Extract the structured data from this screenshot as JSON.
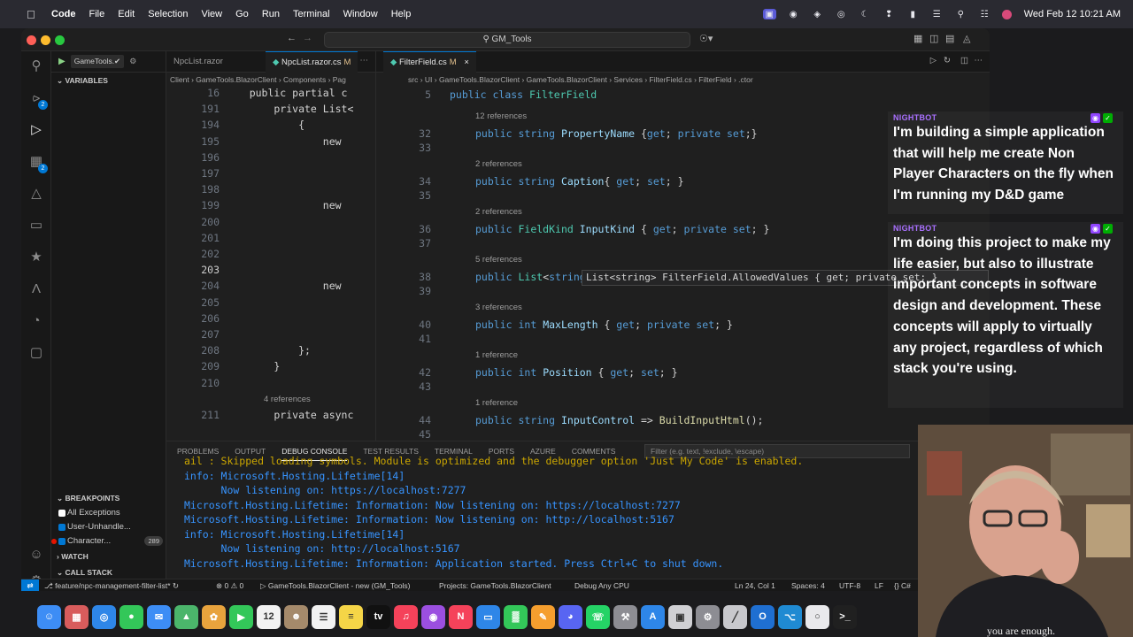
{
  "menubar": {
    "app": "Code",
    "menus": [
      "File",
      "Edit",
      "Selection",
      "View",
      "Go",
      "Run",
      "Terminal",
      "Window",
      "Help"
    ],
    "clock": "Wed Feb 12  10:21 AM"
  },
  "window": {
    "search": "GM_Tools"
  },
  "sidebar": {
    "debug_config": "GameTools.✔",
    "variables_header": "VARIABLES",
    "breakpoints_header": "BREAKPOINTS",
    "breakpoints": [
      {
        "label": "All Exceptions",
        "checked": false
      },
      {
        "label": "User-Unhandle...",
        "checked": true
      },
      {
        "label": "Character...",
        "checked": true,
        "count": "289"
      }
    ],
    "watch_header": "WATCH",
    "callstack_header": "CALL STACK"
  },
  "left_editor": {
    "tabs": [
      {
        "label": "NpcList.razor",
        "modified": ""
      },
      {
        "label": "NpcList.razor.cs",
        "modified": "M"
      }
    ],
    "breadcrumb": "Client › GameTools.BlazorClient › Components › Pag",
    "lines": [
      {
        "num": "16",
        "text": "    public partial c"
      },
      {
        "num": "191",
        "text": "        private List<"
      },
      {
        "num": "194",
        "text": "            {"
      },
      {
        "num": "195",
        "text": "                new "
      },
      {
        "num": "196",
        "text": "                    "
      },
      {
        "num": "197",
        "text": "                    "
      },
      {
        "num": "198",
        "text": "                    "
      },
      {
        "num": "199",
        "text": "                new "
      },
      {
        "num": "200",
        "text": "                    "
      },
      {
        "num": "201",
        "text": "                    "
      },
      {
        "num": "202",
        "text": "                    "
      },
      {
        "num": "203",
        "text": "                    "
      },
      {
        "num": "204",
        "text": "                new "
      },
      {
        "num": "205",
        "text": "                    "
      },
      {
        "num": "206",
        "text": "                    "
      },
      {
        "num": "207",
        "text": "                    "
      },
      {
        "num": "208",
        "text": "            };"
      },
      {
        "num": "209",
        "text": "        }"
      },
      {
        "num": "210",
        "text": ""
      },
      {
        "num": "",
        "text": "        4 references"
      },
      {
        "num": "211",
        "text": "        private async"
      }
    ]
  },
  "right_editor": {
    "tab": "FilterField.cs",
    "tab_modified": "M",
    "breadcrumb": "src › UI › GameTools.BlazorClient › GameTools.BlazorClient › Services › FilterField.cs › FilterField › .ctor",
    "sticky": {
      "num": "5",
      "text": "public class FilterField"
    },
    "hover": "List<string> FilterField.AllowedValues { get; private set; }",
    "members": [
      {
        "refs": "12 references",
        "num": "32",
        "code": "public string PropertyName {get; private set;}"
      },
      {
        "refs": "",
        "num": "33",
        "code": ""
      },
      {
        "refs": "2 references",
        "num": "34",
        "code": "public string Caption{ get; set; }"
      },
      {
        "refs": "",
        "num": "35",
        "code": ""
      },
      {
        "refs": "2 references",
        "num": "36",
        "code": "public FieldKind InputKind { get; private set; }"
      },
      {
        "refs": "",
        "num": "37",
        "code": ""
      },
      {
        "refs": "5 references",
        "num": "38",
        "code": "public List<string> AllowedValues { get; private set; }"
      },
      {
        "refs": "",
        "num": "39",
        "code": ""
      },
      {
        "refs": "3 references",
        "num": "40",
        "code": "public int MaxLength { get; private set; }"
      },
      {
        "refs": "",
        "num": "41",
        "code": ""
      },
      {
        "refs": "1 reference",
        "num": "42",
        "code": "public int Position { get; set; }"
      },
      {
        "refs": "",
        "num": "43",
        "code": ""
      },
      {
        "refs": "1 reference",
        "num": "44",
        "code": "public string InputControl => BuildInputHtml();"
      },
      {
        "refs": "",
        "num": "45",
        "code": ""
      }
    ]
  },
  "panel": {
    "tabs": [
      "PROBLEMS",
      "OUTPUT",
      "DEBUG CONSOLE",
      "TEST RESULTS",
      "TERMINAL",
      "PORTS",
      "AZURE",
      "COMMENTS"
    ],
    "active_tab": "DEBUG CONSOLE",
    "filter_placeholder": "Filter (e.g. text, !exclude, \\escape)",
    "lines": [
      {
        "text": "ail : Skipped loading symbols. Module is optimized and the debugger option 'Just My Code' is enabled.",
        "kind": "warn"
      },
      {
        "text": "info: Microsoft.Hosting.Lifetime[14]",
        "kind": "info"
      },
      {
        "text": "      Now listening on: https://localhost:7277",
        "kind": "info"
      },
      {
        "text": "Microsoft.Hosting.Lifetime: Information: Now listening on: https://localhost:7277",
        "kind": "info"
      },
      {
        "text": "Microsoft.Hosting.Lifetime: Information: Now listening on: http://localhost:5167",
        "kind": "info"
      },
      {
        "text": "info: Microsoft.Hosting.Lifetime[14]",
        "kind": "info"
      },
      {
        "text": "      Now listening on: http://localhost:5167",
        "kind": "info"
      },
      {
        "text": "Microsoft.Hosting.Lifetime: Information: Application started. Press Ctrl+C to shut down.",
        "kind": "info"
      }
    ]
  },
  "statusbar": {
    "branch": "feature/npc-management-filter-list*",
    "problems": "⊗ 0 ⚠ 0",
    "debug_target": "GameTools.BlazorClient - new (GM_Tools)",
    "projects": "Projects: GameTools.BlazorClient",
    "config": "Debug Any CPU",
    "position": "Ln 24, Col 1",
    "spaces": "Spaces: 4",
    "encoding": "UTF-8",
    "eol": "LF",
    "language": "{} C#"
  },
  "chat": [
    {
      "user": "NIGHTBOT",
      "message": "I'm building a simple application that will help me create Non Player Characters on the fly when I'm running my D&D game"
    },
    {
      "user": "NIGHTBOT",
      "message": "I'm doing this project to make my life easier, but also to illustrate important concepts in software design and development. These concepts will apply to virtually any project, regardless of which stack you're using."
    }
  ],
  "webcam": {
    "shirt_text": "you are enough."
  },
  "dock": {
    "apps": [
      {
        "name": "finder",
        "color": "#3d8df5",
        "glyph": "☺"
      },
      {
        "name": "launchpad",
        "color": "#d85c5c",
        "glyph": "▦"
      },
      {
        "name": "safari",
        "color": "#2e86e8",
        "glyph": "◎"
      },
      {
        "name": "messages",
        "color": "#33c759",
        "glyph": "●"
      },
      {
        "name": "mail",
        "color": "#3d8df5",
        "glyph": "✉"
      },
      {
        "name": "maps",
        "color": "#4bb56b",
        "glyph": "▲"
      },
      {
        "name": "photos",
        "color": "#e8a33d",
        "glyph": "✿"
      },
      {
        "name": "facetime",
        "color": "#33c759",
        "glyph": "▶"
      },
      {
        "name": "calendar",
        "color": "#f2f2f2",
        "glyph": "12"
      },
      {
        "name": "contacts",
        "color": "#a58a6b",
        "glyph": "☻"
      },
      {
        "name": "reminders",
        "color": "#f2f2f2",
        "glyph": "☰"
      },
      {
        "name": "notes",
        "color": "#f5d547",
        "glyph": "≡"
      },
      {
        "name": "tv",
        "color": "#111111",
        "glyph": "tv"
      },
      {
        "name": "music",
        "color": "#f5425a",
        "glyph": "♫"
      },
      {
        "name": "podcasts",
        "color": "#9b4fe0",
        "glyph": "◉"
      },
      {
        "name": "news",
        "color": "#f5425a",
        "glyph": "N"
      },
      {
        "name": "keynote",
        "color": "#2e86e8",
        "glyph": "▭"
      },
      {
        "name": "numbers",
        "color": "#33c759",
        "glyph": "▓"
      },
      {
        "name": "pages",
        "color": "#f59e2e",
        "glyph": "✎"
      },
      {
        "name": "discord",
        "color": "#5865f2",
        "glyph": "◕"
      },
      {
        "name": "whatsapp",
        "color": "#25d366",
        "glyph": "☏"
      },
      {
        "name": "xcode-tools",
        "color": "#8d8d93",
        "glyph": "⚒"
      },
      {
        "name": "app-store",
        "color": "#2e86e8",
        "glyph": "A"
      },
      {
        "name": "screenshot",
        "color": "#d0d0d4",
        "glyph": "▣"
      },
      {
        "name": "system-settings",
        "color": "#8d8d93",
        "glyph": "⚙"
      },
      {
        "name": "instruments",
        "color": "#c8c8cc",
        "glyph": "╱"
      },
      {
        "name": "outlook",
        "color": "#1f6fd1",
        "glyph": "O"
      },
      {
        "name": "vscode",
        "color": "#1f8ad2",
        "glyph": "⌥"
      },
      {
        "name": "obs",
        "color": "#e9e9ec",
        "glyph": "○"
      },
      {
        "name": "terminal",
        "color": "#202020",
        "glyph": ">_"
      }
    ]
  },
  "colors": {
    "accent": "#0078d4",
    "chat_user": "#a970ff",
    "console_info": "#3794ff",
    "console_warn": "#cca700"
  }
}
